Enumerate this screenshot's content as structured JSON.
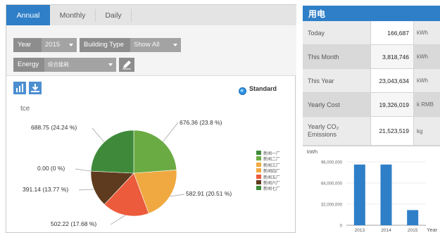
{
  "tabs": [
    {
      "label": "Annual",
      "active": true
    },
    {
      "label": "Monthly",
      "active": false
    },
    {
      "label": "Daily",
      "active": false
    }
  ],
  "filters": {
    "year_label": "Year",
    "year_value": "2015",
    "building_type_label": "Building Type",
    "building_type_value": "Show All",
    "energy_label": "Energy",
    "energy_value": "综合能耗"
  },
  "toolbar": {
    "chart_icon": "bar-chart-icon",
    "download_icon": "download-icon",
    "edit_icon": "edit-icon"
  },
  "standard_label": "Standard",
  "pie_unit": "tce",
  "chart_data": [
    {
      "type": "pie",
      "unit": "tce",
      "slices": [
        {
          "label": "676.36 (23.8 %)",
          "value": 676.36,
          "percent": 23.8,
          "color": "#6aab44"
        },
        {
          "label": "582.91 (20.51 %)",
          "value": 582.91,
          "percent": 20.51,
          "color": "#f0a940"
        },
        {
          "label": "502.22 (17.68 %)",
          "value": 502.22,
          "percent": 17.68,
          "color": "#eb5b3c"
        },
        {
          "label": "391.14 (13.77 %)",
          "value": 391.14,
          "percent": 13.77,
          "color": "#5e3b1e"
        },
        {
          "label": "0.00 (0 %)",
          "value": 0.0,
          "percent": 0.0,
          "color": "#aaaaaa"
        },
        {
          "label": "688.75 (24.24 %)",
          "value": 688.75,
          "percent": 24.24,
          "color": "#3e8a3a"
        }
      ],
      "legend": [
        {
          "label": "新闻一厂",
          "color": "#3e8a3a"
        },
        {
          "label": "新闻二厂",
          "color": "#6aab44"
        },
        {
          "label": "新闻三厂",
          "color": "#f0a940"
        },
        {
          "label": "新闻四厂",
          "color": "#f0a940"
        },
        {
          "label": "新闻五厂",
          "color": "#eb5b3c"
        },
        {
          "label": "新闻六厂",
          "color": "#5e3b1e"
        },
        {
          "label": "新闻七厂",
          "color": "#3e8a3a"
        }
      ]
    },
    {
      "type": "bar",
      "ylabel": "kWh",
      "xlabel": "Year",
      "categories": [
        "2013",
        "2014",
        "2015"
      ],
      "values": [
        92000000,
        92000000,
        23000000
      ],
      "ylim": [
        0,
        96000000
      ],
      "yticks": [
        "96,000,000",
        "64,000,000",
        "32,000,000",
        "0"
      ],
      "ytick_values": [
        96000000,
        64000000,
        32000000,
        0
      ],
      "color": "#2f7fc8"
    }
  ],
  "summary": {
    "title": "用电",
    "rows": [
      {
        "label": "Today",
        "value": "166,687",
        "unit": "kWh",
        "shade": false
      },
      {
        "label": "This Month",
        "value": "3,818,746",
        "unit": "kWh",
        "shade": true
      },
      {
        "label": "This Year",
        "value": "23,043,634",
        "unit": "kWh",
        "shade": false
      },
      {
        "label": "Yearly Cost",
        "value": "19,326,019",
        "unit": "k RMB",
        "shade": true
      },
      {
        "label": "Yearly CO₂ Emissions",
        "value": "21,523,519",
        "unit": "kg",
        "shade": false
      }
    ]
  }
}
